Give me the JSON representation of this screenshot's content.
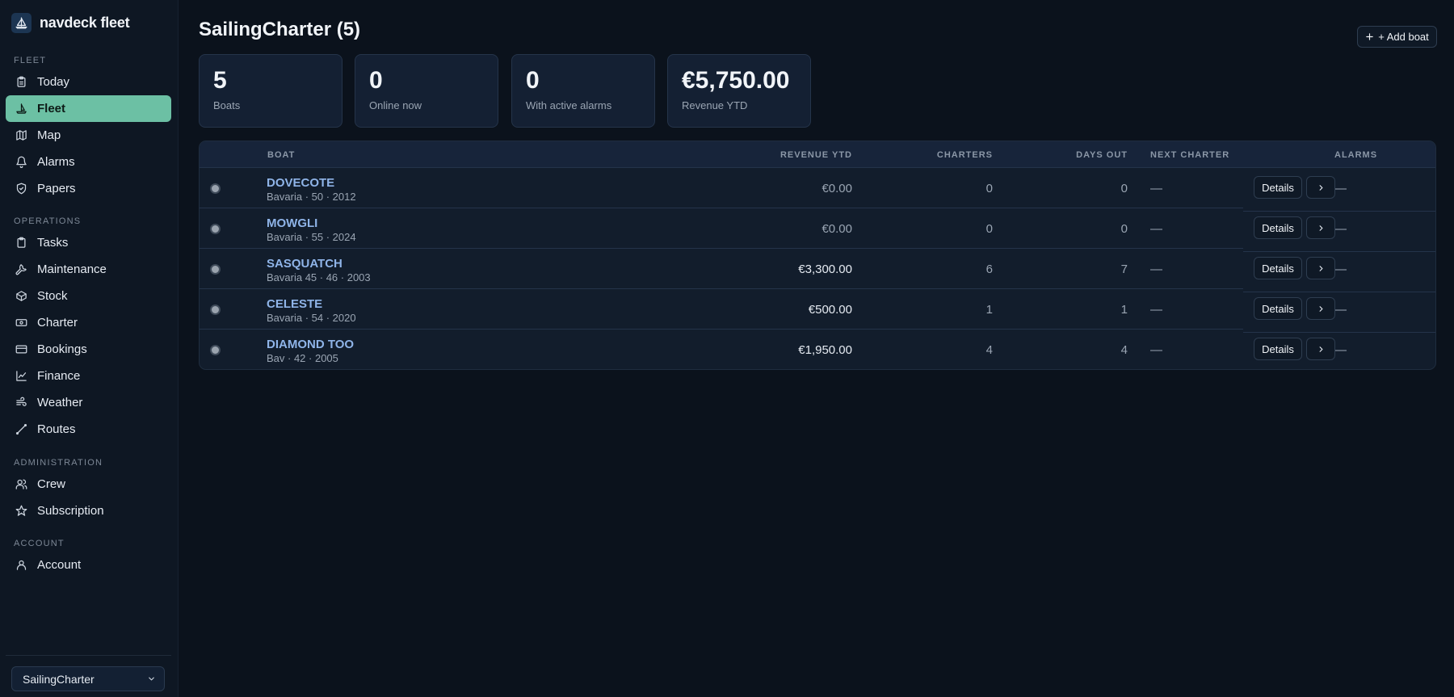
{
  "brand": {
    "name": "navdeck fleet",
    "logo_icon": "sailboat-icon"
  },
  "sidebar": {
    "sections": [
      {
        "label": "FLEET",
        "items": [
          {
            "label": "Today",
            "icon": "clipboard-icon"
          },
          {
            "label": "Fleet",
            "icon": "sailboat-icon",
            "active": true
          },
          {
            "label": "Map",
            "icon": "map-icon"
          },
          {
            "label": "Alarms",
            "icon": "bell-icon"
          },
          {
            "label": "Papers",
            "icon": "shield-check-icon"
          }
        ]
      },
      {
        "label": "OPERATIONS",
        "items": [
          {
            "label": "Tasks",
            "icon": "clipboard-icon"
          },
          {
            "label": "Maintenance",
            "icon": "wrench-icon"
          },
          {
            "label": "Stock",
            "icon": "box-icon"
          },
          {
            "label": "Charter",
            "icon": "banknote-icon"
          },
          {
            "label": "Bookings",
            "icon": "credit-card-icon"
          },
          {
            "label": "Finance",
            "icon": "line-chart-icon"
          },
          {
            "label": "Weather",
            "icon": "wind-icon"
          },
          {
            "label": "Routes",
            "icon": "route-icon"
          }
        ]
      },
      {
        "label": "ADMINISTRATION",
        "items": [
          {
            "label": "Crew",
            "icon": "users-icon"
          },
          {
            "label": "Subscription",
            "icon": "star-icon"
          }
        ]
      },
      {
        "label": "ACCOUNT",
        "items": [
          {
            "label": "Account",
            "icon": "user-icon"
          }
        ]
      }
    ],
    "org_select": {
      "value": "SailingCharter"
    }
  },
  "header": {
    "title": "SailingCharter (5)",
    "add_button_label": "+ Add boat"
  },
  "stats": [
    {
      "value": "5",
      "label": "Boats"
    },
    {
      "value": "0",
      "label": "Online now"
    },
    {
      "value": "0",
      "label": "With active alarms"
    },
    {
      "value": "€5,750.00",
      "label": "Revenue YTD"
    }
  ],
  "table": {
    "columns": {
      "boat": "BOAT",
      "revenue": "REVENUE YTD",
      "charters": "CHARTERS",
      "days_out": "DAYS OUT",
      "next_charter": "NEXT CHARTER",
      "alarms": "ALARMS"
    },
    "details_label": "Details",
    "rows": [
      {
        "name": "DOVECOTE",
        "meta": "Bavaria · 50 · 2012",
        "revenue": "€0.00",
        "charters": "0",
        "days_out": "0",
        "next_charter": "—",
        "alarms": "—"
      },
      {
        "name": "MOWGLI",
        "meta": "Bavaria · 55 · 2024",
        "revenue": "€0.00",
        "charters": "0",
        "days_out": "0",
        "next_charter": "—",
        "alarms": "—"
      },
      {
        "name": "SASQUATCH",
        "meta": "Bavaria 45 · 46 · 2003",
        "revenue": "€3,300.00",
        "charters": "6",
        "days_out": "7",
        "next_charter": "—",
        "alarms": "—"
      },
      {
        "name": "CELESTE",
        "meta": "Bavaria · 54 · 2020",
        "revenue": "€500.00",
        "charters": "1",
        "days_out": "1",
        "next_charter": "—",
        "alarms": "—"
      },
      {
        "name": "DIAMOND TOO",
        "meta": "Bav · 42 · 2005",
        "revenue": "€1,950.00",
        "charters": "4",
        "days_out": "4",
        "next_charter": "—",
        "alarms": "—"
      }
    ]
  },
  "colors": {
    "accent": "#6cc0a4",
    "link": "#8fb4e8",
    "background": "#0b121c"
  }
}
